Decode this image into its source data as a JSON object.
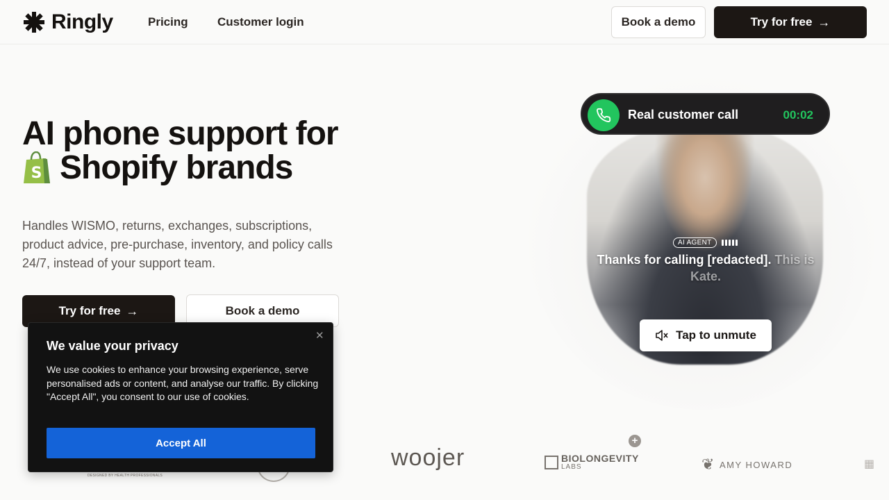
{
  "nav": {
    "brand": "Ringly",
    "links": [
      "Pricing",
      "Customer login"
    ],
    "book_demo": "Book a demo",
    "try_free": "Try for free"
  },
  "hero": {
    "title_line1": "AI phone support for",
    "title_line2": "Shopify brands",
    "subtitle": "Handles WISMO, returns, exchanges, subscriptions, product advice, pre-purchase, inventory, and policy calls 24/7, instead of your support team.",
    "try_free": "Try for free",
    "book_demo": "Book a demo"
  },
  "call": {
    "label": "Real customer call",
    "timer": "00:02",
    "agent_tag": "AI AGENT",
    "caption_spoken": "Thanks for calling [redacted].",
    "caption_pending": "This is Kate.",
    "unmute": "Tap to unmute"
  },
  "logos": {
    "woojer": "woojer",
    "bio_line1": "BIOLONGEVITY",
    "bio_line2": "LABS",
    "amy": "AMY HOWARD",
    "dph": "DESIGNED BY HEALTH PROFESSIONALS"
  },
  "cookie": {
    "title": "We value your privacy",
    "body": "We use cookies to enhance your browsing experience, serve personalised ads or content, and analyse our traffic. By clicking \"Accept All\", you consent to our use of cookies.",
    "accept": "Accept All"
  },
  "colors": {
    "primary_dark": "#1c1714",
    "call_green": "#22c55e",
    "accept_blue": "#1463d8",
    "shopify_green": "#95bf47"
  }
}
